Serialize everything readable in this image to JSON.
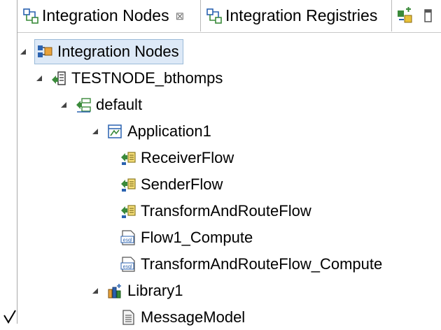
{
  "tabs": [
    {
      "label": "Integration Nodes",
      "active": true,
      "close_glyph": "⊠"
    },
    {
      "label": "Integration Registries",
      "active": false
    }
  ],
  "toolbar": {
    "icons": [
      "new-node-icon",
      "minimize-icon"
    ]
  },
  "tree": {
    "root": {
      "label": "Integration Nodes",
      "icon": "integration-nodes-icon",
      "selected": true
    },
    "node": {
      "label": "TESTNODE_bthomps",
      "icon": "integration-node-icon"
    },
    "server": {
      "label": "default",
      "icon": "integration-server-icon"
    },
    "application": {
      "label": "Application1",
      "icon": "application-icon",
      "children": [
        {
          "label": "ReceiverFlow",
          "icon": "message-flow-icon"
        },
        {
          "label": "SenderFlow",
          "icon": "message-flow-icon"
        },
        {
          "label": "TransformAndRouteFlow",
          "icon": "message-flow-icon"
        },
        {
          "label": "Flow1_Compute",
          "icon": "esql-icon"
        },
        {
          "label": "TransformAndRouteFlow_Compute",
          "icon": "esql-icon"
        }
      ]
    },
    "library": {
      "label": "Library1",
      "icon": "library-icon",
      "children": [
        {
          "label": "MessageModel",
          "icon": "document-icon"
        }
      ]
    }
  },
  "colors": {
    "selection_bg": "#dde9f7",
    "selection_border": "#9bbbd9",
    "icon_green": "#3a8a3a",
    "icon_blue": "#2a62b0"
  }
}
